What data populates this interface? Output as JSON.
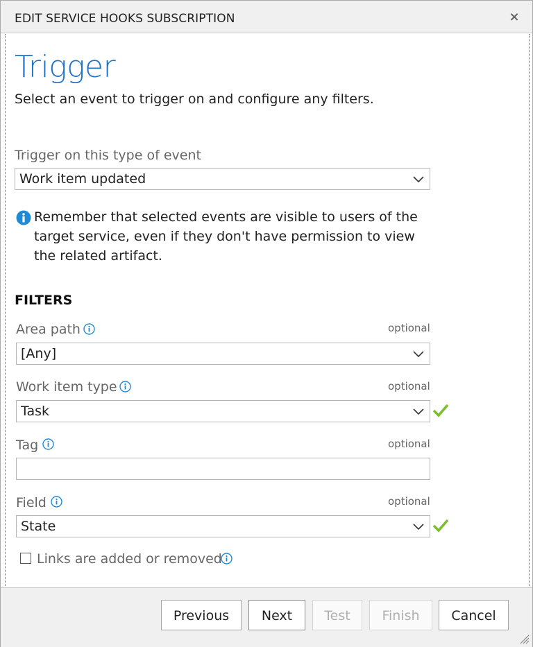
{
  "dialog": {
    "title": "EDIT SERVICE HOOKS SUBSCRIPTION",
    "close_glyph": "×"
  },
  "page": {
    "heading": "Trigger",
    "subtitle": "Select an event to trigger on and configure any filters."
  },
  "event": {
    "label": "Trigger on this type of event",
    "value": "Work item updated"
  },
  "note": {
    "icon": "info-icon",
    "text": "Remember that selected events are visible to users of the target service, even if they don't have permission to view the related artifact."
  },
  "filters": {
    "heading": "FILTERS",
    "optional_text": "optional",
    "area_path": {
      "label": "Area path",
      "value": "[Any]"
    },
    "work_item_type": {
      "label": "Work item type",
      "value": "Task",
      "valid": true
    },
    "tag": {
      "label": "Tag",
      "value": ""
    },
    "field": {
      "label": "Field",
      "value": "State",
      "valid": true
    },
    "links_checkbox": {
      "label": "Links are added or removed",
      "checked": false
    }
  },
  "footer": {
    "previous": "Previous",
    "next": "Next",
    "test": "Test",
    "finish": "Finish",
    "cancel": "Cancel"
  },
  "colors": {
    "accent": "#1e72c8",
    "info": "#1e8ad6",
    "check": "#7cbf2e"
  }
}
